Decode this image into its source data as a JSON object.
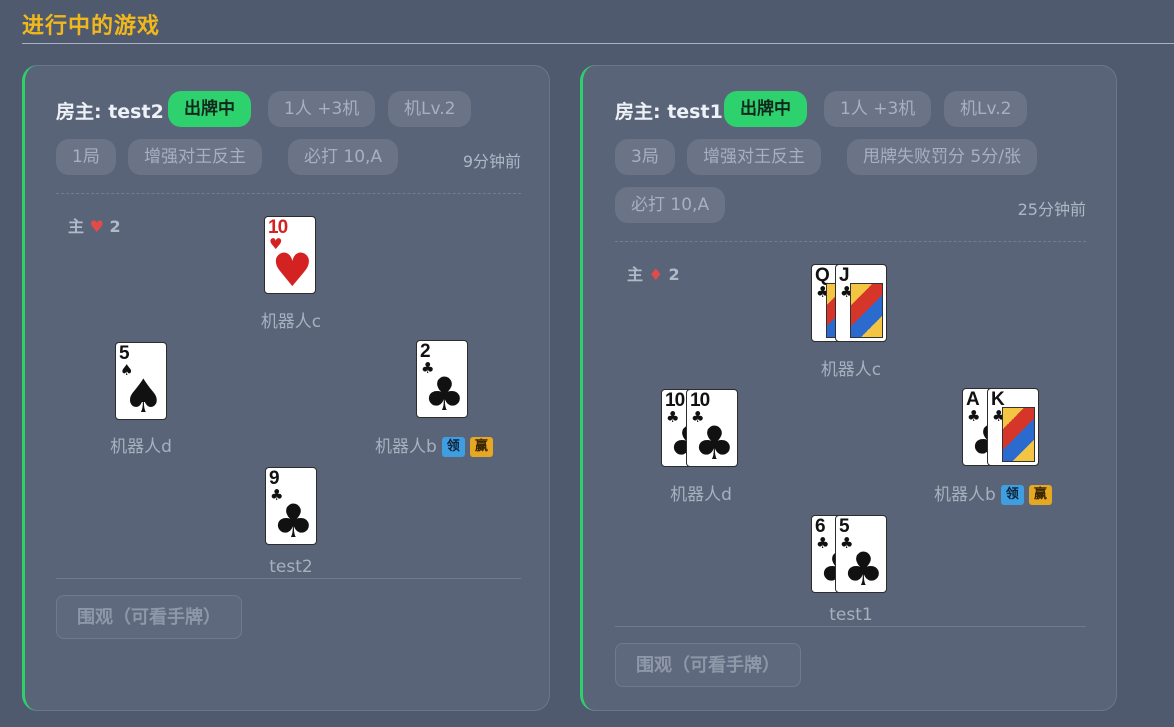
{
  "section": {
    "title": "进行中的游戏"
  },
  "games": [
    {
      "host": "房主: test2",
      "status": "出牌中",
      "tags": [
        "1人 +3机",
        "机Lv.2",
        "1局",
        "增强对王反主",
        "必打 10,A"
      ],
      "time_ago": "9分钟前",
      "trump": {
        "label": "主",
        "suit": "♥",
        "suit_color": "#e34b4b",
        "rank": "2"
      },
      "players": {
        "top": {
          "name": "机器人c",
          "cards": [
            {
              "rank": "10",
              "suit": "♥",
              "color": "red"
            }
          ]
        },
        "left": {
          "name": "机器人d",
          "cards": [
            {
              "rank": "5",
              "suit": "♠",
              "color": "black"
            }
          ]
        },
        "right": {
          "name": "机器人b",
          "badges": [
            "领",
            "赢"
          ],
          "cards": [
            {
              "rank": "2",
              "suit": "♣",
              "color": "black"
            }
          ]
        },
        "bottom": {
          "name": "test2",
          "cards": [
            {
              "rank": "9",
              "suit": "♣",
              "color": "black"
            }
          ]
        }
      },
      "spectate_label": "围观（可看手牌）"
    },
    {
      "host": "房主: test1",
      "status": "出牌中",
      "tags": [
        "1人 +3机",
        "机Lv.2",
        "3局",
        "增强对王反主",
        "甩牌失败罚分 5分/张",
        "必打 10,A"
      ],
      "time_ago": "25分钟前",
      "trump": {
        "label": "主",
        "suit": "♦",
        "suit_color": "#e34b4b",
        "rank": "2"
      },
      "players": {
        "top": {
          "name": "机器人c",
          "cards": [
            {
              "rank": "Q",
              "suit": "♣",
              "color": "black"
            },
            {
              "rank": "J",
              "suit": "♣",
              "color": "black",
              "face": true
            }
          ]
        },
        "left": {
          "name": "机器人d",
          "cards": [
            {
              "rank": "10",
              "suit": "♣",
              "color": "black"
            },
            {
              "rank": "10",
              "suit": "♣",
              "color": "black"
            }
          ]
        },
        "right": {
          "name": "机器人b",
          "badges": [
            "领",
            "赢"
          ],
          "cards": [
            {
              "rank": "A",
              "suit": "♣",
              "color": "black"
            },
            {
              "rank": "K",
              "suit": "♣",
              "color": "black",
              "face": true
            }
          ]
        },
        "bottom": {
          "name": "test1",
          "cards": [
            {
              "rank": "6",
              "suit": "♣",
              "color": "black"
            },
            {
              "rank": "5",
              "suit": "♣",
              "color": "black"
            }
          ]
        }
      },
      "spectate_label": "围观（可看手牌）"
    }
  ],
  "colors": {
    "accent": "#2dd16e",
    "title": "#f0b81a",
    "background": "#505a6e",
    "card_bg": "#5a6478",
    "lead_badge": "#3f9ee0",
    "win_badge": "#e6a823"
  }
}
